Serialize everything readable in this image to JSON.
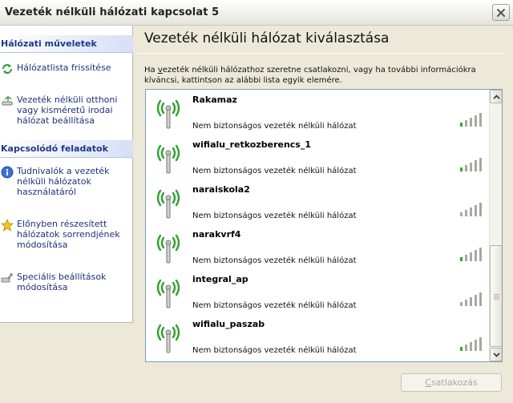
{
  "window": {
    "title": "Vezeték nélküli hálózati kapcsolat 5"
  },
  "taskpane": {
    "network_tasks": {
      "header": "Hálózati műveletek",
      "items": [
        {
          "label": "Hálózatlista frissítése",
          "icon": "refresh-icon"
        },
        {
          "label": "Vezeték nélküli otthoni vagy kisméretű irodai hálózat beállítása",
          "icon": "wireless-setup-icon"
        }
      ]
    },
    "related_tasks": {
      "header": "Kapcsolódó feladatok",
      "items": [
        {
          "label": "Tudnivalók a vezeték nélküli hálózatok használatáról",
          "icon": "info-icon"
        },
        {
          "label": "Előnyben részesített hálózatok sorrendjének módosítása",
          "icon": "star-icon"
        },
        {
          "label": "Speciális beállítások módosítása",
          "icon": "settings-icon"
        }
      ]
    }
  },
  "main": {
    "heading": "Vezeték nélküli hálózat kiválasztása",
    "description_pre": "Ha ",
    "description_link": "v",
    "description_post": "ezeték nélküli hálózathoz szeretne csatlakozni, vagy ha további információkra kíváncsi, kattintson az alábbi lista egyik elemére.",
    "networks": [
      {
        "ssid": "Rakamaz",
        "security": "Nem biztonságos vezeték nélküli hálózat",
        "signal_bars": 1
      },
      {
        "ssid": "wifialu_retkozberencs_1",
        "security": "Nem biztonságos vezeték nélküli hálózat",
        "signal_bars": 1
      },
      {
        "ssid": "naraiskola2",
        "security": "Nem biztonságos vezeték nélküli hálózat",
        "signal_bars": 0
      },
      {
        "ssid": "narakvrf4",
        "security": "Nem biztonságos vezeték nélküli hálózat",
        "signal_bars": 1
      },
      {
        "ssid": "integral_ap",
        "security": "Nem biztonságos vezeték nélküli hálózat",
        "signal_bars": 0
      },
      {
        "ssid": "wifialu_paszab",
        "security": "Nem biztonságos vezeték nélküli hálózat",
        "signal_bars": 1
      }
    ],
    "connect_label_pre": "",
    "connect_label_u": "C",
    "connect_label_post": "satlakozás"
  },
  "colors": {
    "task_link": "#1e3276",
    "pane_header": "#1d3a8a",
    "signal_active": "#2ea82e",
    "signal_inactive": "#a8a8a0",
    "wireless_icon": "#2fa12f"
  }
}
